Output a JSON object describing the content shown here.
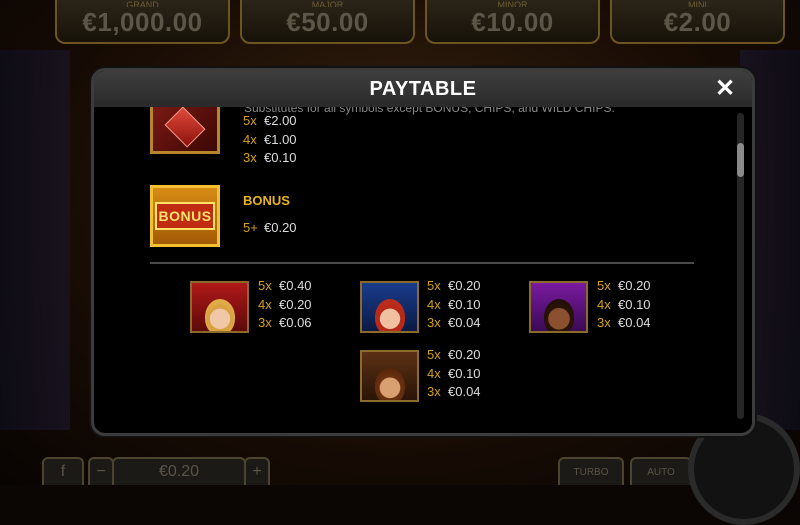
{
  "jackpots": [
    {
      "label": "GRAND",
      "value": "€1,000.00"
    },
    {
      "label": "MAJOR",
      "value": "€50.00"
    },
    {
      "label": "MINOR",
      "value": "€10.00"
    },
    {
      "label": "MINI",
      "value": "€2.00"
    }
  ],
  "bottom_bar": {
    "bet_value": "€0.20",
    "auto_label": "AUTO",
    "turbo_label": "TURBO"
  },
  "modal": {
    "title": "PAYTABLE",
    "close_icon": "close-icon",
    "cut_text": "Substitutes for all symbols except BONUS, CHIPS, and WILD CHIPS.",
    "wild": {
      "icon": "wild-gem-icon",
      "pays": [
        {
          "mult": "5x",
          "amount": "€2.00"
        },
        {
          "mult": "4x",
          "amount": "€1.00"
        },
        {
          "mult": "3x",
          "amount": "€0.10"
        }
      ]
    },
    "bonus": {
      "icon_text": "BONUS",
      "title": "BONUS",
      "pays": [
        {
          "mult": "5+",
          "amount": "€0.20"
        }
      ]
    },
    "characters": [
      {
        "icon": "blonde-woman-icon",
        "pays": [
          {
            "mult": "5x",
            "amount": "€0.40"
          },
          {
            "mult": "4x",
            "amount": "€0.20"
          },
          {
            "mult": "3x",
            "amount": "€0.06"
          }
        ]
      },
      {
        "icon": "redhead-woman-icon",
        "pays": [
          {
            "mult": "5x",
            "amount": "€0.20"
          },
          {
            "mult": "4x",
            "amount": "€0.10"
          },
          {
            "mult": "3x",
            "amount": "€0.04"
          }
        ]
      },
      {
        "icon": "purple-woman-icon",
        "pays": [
          {
            "mult": "5x",
            "amount": "€0.20"
          },
          {
            "mult": "4x",
            "amount": "€0.10"
          },
          {
            "mult": "3x",
            "amount": "€0.04"
          }
        ]
      },
      {
        "icon": "brunette-woman-icon",
        "pays": [
          {
            "mult": "5x",
            "amount": "€0.20"
          },
          {
            "mult": "4x",
            "amount": "€0.10"
          },
          {
            "mult": "3x",
            "amount": "€0.04"
          }
        ]
      }
    ]
  }
}
